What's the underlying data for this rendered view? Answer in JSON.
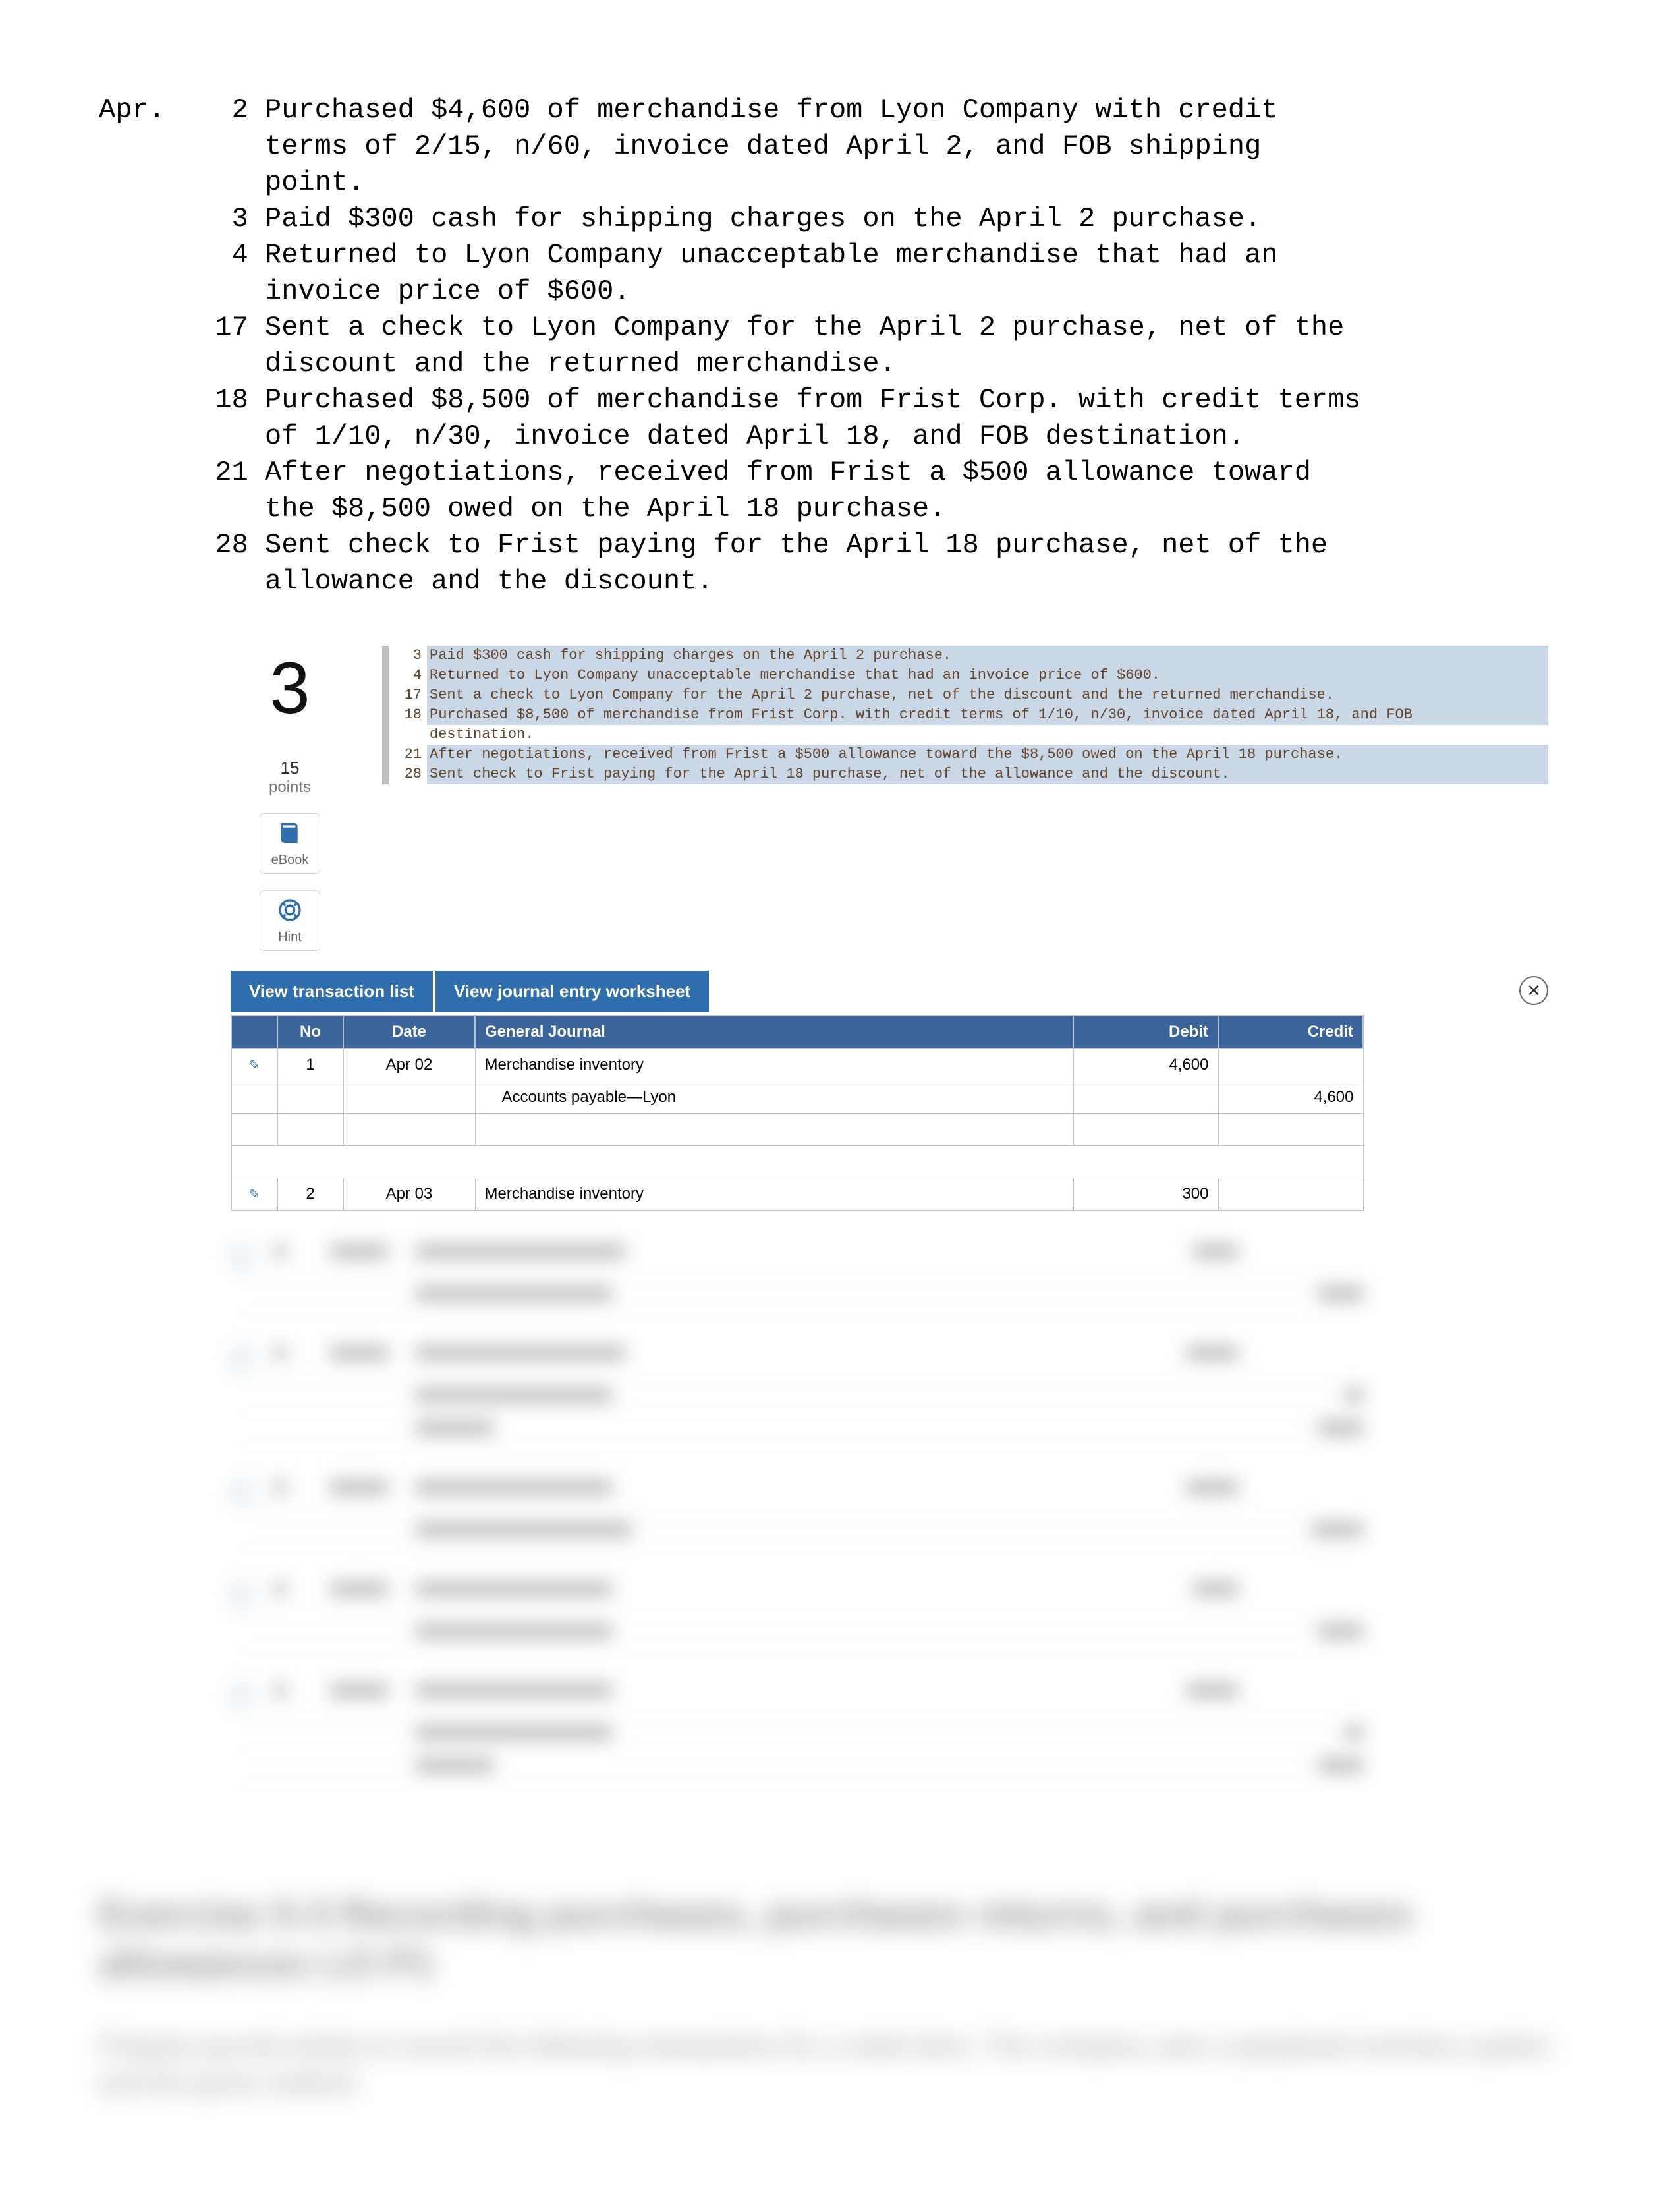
{
  "month_label": "Apr.",
  "transactions": [
    {
      "day": "2",
      "text": "Purchased $4,600 of merchandise from Lyon Company with credit\nterms of 2/15, n/60, invoice dated April 2, and FOB shipping\npoint."
    },
    {
      "day": "3",
      "text": "Paid $300 cash for shipping charges on the April 2 purchase."
    },
    {
      "day": "4",
      "text": "Returned to Lyon Company unacceptable merchandise that had an\ninvoice price of $600."
    },
    {
      "day": "17",
      "text": "Sent a check to Lyon Company for the April 2 purchase, net of the\ndiscount and the returned merchandise."
    },
    {
      "day": "18",
      "text": "Purchased $8,500 of merchandise from Frist Corp. with credit terms\nof 1/10, n/30, invoice dated April 18, and FOB destination."
    },
    {
      "day": "21",
      "text": "After negotiations, received from Frist a $500 allowance toward\nthe $8,500 owed on the April 18 purchase."
    },
    {
      "day": "28",
      "text": "Sent check to Frist paying for the April 18 purchase, net of the\nallowance and the discount."
    }
  ],
  "question_number": "3",
  "points_value": "15",
  "points_label": "points",
  "rail": {
    "ebook_label": "eBook",
    "hint_label": "Hint"
  },
  "snippet": [
    {
      "n": "3",
      "t": "Paid $300 cash for shipping charges on the April 2 purchase.",
      "hl": true
    },
    {
      "n": "4",
      "t": "Returned to Lyon Company unacceptable merchandise that had an invoice price of $600.",
      "hl": true
    },
    {
      "n": "17",
      "t": "Sent a check to Lyon Company for the April 2 purchase, net of the discount and the returned merchandise.",
      "hl": true
    },
    {
      "n": "18",
      "t": "Purchased $8,500 of merchandise from Frist Corp. with credit terms of 1/10, n/30, invoice dated April 18, and FOB",
      "hl": true
    },
    {
      "n": "",
      "t": "destination.",
      "hl": false
    },
    {
      "n": "21",
      "t": "After negotiations, received from Frist a $500 allowance toward the $8,500 owed on the April 18 purchase.",
      "hl": true
    },
    {
      "n": "28",
      "t": "Sent check to Frist paying for the April 18 purchase, net of the allowance and the discount.",
      "hl": true
    }
  ],
  "tabs": {
    "list": "View transaction list",
    "entry": "View journal entry worksheet"
  },
  "close_glyph": "✕",
  "journal": {
    "headers": {
      "no": "No",
      "date": "Date",
      "gj": "General Journal",
      "debit": "Debit",
      "credit": "Credit"
    },
    "rows": [
      {
        "edit": true,
        "no": "1",
        "date": "Apr 02",
        "account": "Merchandise inventory",
        "debit": "4,600",
        "credit": ""
      },
      {
        "edit": false,
        "no": "",
        "date": "",
        "account": "Accounts payable—Lyon",
        "debit": "",
        "credit": "4,600"
      },
      {
        "edit": false,
        "no": "",
        "date": "",
        "account": "",
        "debit": "",
        "credit": ""
      },
      {
        "spacer": true
      },
      {
        "edit": true,
        "no": "2",
        "date": "Apr 03",
        "account": "Merchandise inventory",
        "debit": "300",
        "credit": ""
      }
    ]
  },
  "bottom": {
    "title_l1": "Exercise 5-3 Recording purchases, purchases returns, and purchases",
    "title_l2": "allowances LO P1",
    "para": "Prepare journal entries to record the following transactions for a retail store. The company uses a perpetual inventory system and the gross method."
  }
}
